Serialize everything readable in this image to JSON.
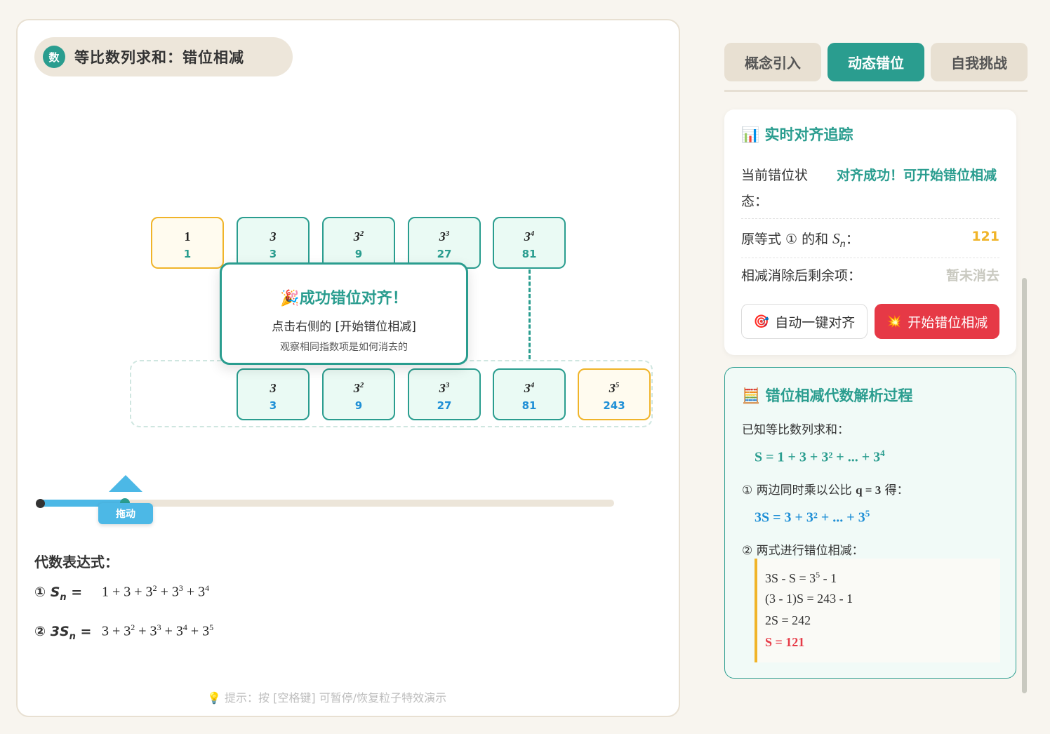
{
  "header": {
    "badge": "数",
    "title": "等比数列求和：错位相减"
  },
  "cards_top": [
    {
      "base": "1",
      "exp": "",
      "value": "1",
      "highlight": true
    },
    {
      "base": "3",
      "exp": "",
      "value": "3",
      "highlight": false
    },
    {
      "base": "3",
      "exp": "2",
      "value": "9",
      "highlight": false
    },
    {
      "base": "3",
      "exp": "3",
      "value": "27",
      "highlight": false
    },
    {
      "base": "3",
      "exp": "4",
      "value": "81",
      "highlight": false
    }
  ],
  "cards_bottom": [
    {
      "base": "3",
      "exp": "",
      "value": "3",
      "highlight": false
    },
    {
      "base": "3",
      "exp": "2",
      "value": "9",
      "highlight": false
    },
    {
      "base": "3",
      "exp": "3",
      "value": "27",
      "highlight": false
    },
    {
      "base": "3",
      "exp": "4",
      "value": "81",
      "highlight": false
    },
    {
      "base": "3",
      "exp": "5",
      "value": "243",
      "highlight": true
    }
  ],
  "toast": {
    "icon": "🎉",
    "title": "成功错位对齐！",
    "line": "点击右侧的 [开始错位相减]",
    "sub": "观察相同指数项是如何消去的"
  },
  "slider": {
    "handle_label": "拖动",
    "progress": 0.15
  },
  "algebra": {
    "title": "代数表达式：",
    "eq1_circ": "①",
    "eq1_label": "S",
    "eq1_sub": "n",
    "eq1_eq": "=",
    "eq2_circ": "②",
    "eq2_label": "3S",
    "eq2_sub": "n",
    "eq2_eq": "="
  },
  "hint": {
    "icon": "💡",
    "text": "提示：按 [空格键] 可暂停/恢复粒子特效演示"
  },
  "tabs": [
    {
      "label": "概念引入",
      "active": false
    },
    {
      "label": "动态错位",
      "active": true
    },
    {
      "label": "自我挑战",
      "active": false
    }
  ],
  "tracker": {
    "icon": "📊",
    "title": "实时对齐追踪",
    "status_key": "当前错位状态：",
    "status_value": "对齐成功！可开始错位相减",
    "sum_key_pre": "原等式 ① 的和 ",
    "sum_key_var": "S",
    "sum_key_sub": "n",
    "sum_key_post": "：",
    "sum_value": "121",
    "remain_key": "相减消除后剩余项：",
    "remain_value": "暂未消去",
    "auto_icon": "🎯",
    "auto_label": "自动一键对齐",
    "start_icon": "💥",
    "start_label": "开始错位相减"
  },
  "analysis": {
    "icon": "🧮",
    "title": "错位相减代数解析过程",
    "known": "已知等比数列求和：",
    "step1_pre": "① 两边同时乘以公比 ",
    "step1_q": "q = 3",
    "step1_post": " 得：",
    "step2": "② 两式进行错位相减："
  },
  "colors": {
    "accent": "#2a9d8f",
    "gold": "#f0b429",
    "blue": "#1f8fd6",
    "red": "#e63946"
  }
}
